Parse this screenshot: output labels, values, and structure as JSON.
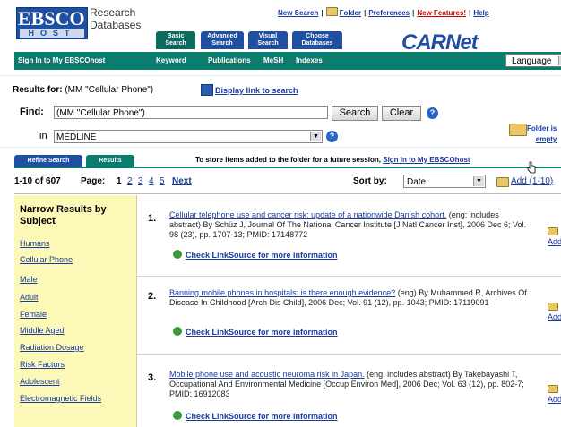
{
  "header": {
    "logo_main": "EBSCO",
    "logo_sub": "HOST",
    "logo_line1": "Research",
    "logo_line2": "Databases",
    "toplinks": [
      "New Search",
      "Folder",
      "Preferences",
      "New Features!",
      "Help"
    ],
    "tabs": [
      {
        "line1": "Basic",
        "line2": "Search"
      },
      {
        "line1": "Advanced",
        "line2": "Search"
      },
      {
        "line1": "Visual",
        "line2": "Search"
      },
      {
        "line1": "Choose",
        "line2": "Databases"
      }
    ],
    "brand": "CARNet"
  },
  "navbar": {
    "signin": "Sign In to My EBSCOhost",
    "items": [
      "Keyword",
      "Publications",
      "MeSH",
      "Indexes"
    ],
    "language": "Language"
  },
  "search": {
    "results_for_label": "Results for:",
    "results_for_query": "(MM \"Cellular Phone\")",
    "display_link": "Display link to search",
    "find_label": "Find:",
    "find_value": "(MM \"Cellular Phone\")",
    "search_button": "Search",
    "clear_button": "Clear",
    "in_label": "in",
    "database": "MEDLINE",
    "folder_text": "Folder is",
    "folder_status": "empty"
  },
  "results_tabs": {
    "refine": "Refine Search",
    "results": "Results",
    "store_message": "To store items added to the folder for a future session,",
    "store_link": "Sign In to My EBSCOhost"
  },
  "pagination": {
    "range": "1-10 of 607",
    "page_label": "Page:",
    "current": "1",
    "pages": [
      "2",
      "3",
      "4",
      "5"
    ],
    "next": "Next",
    "sort_label": "Sort by:",
    "sort_value": "Date",
    "add_link": "Add (1-10)"
  },
  "sidebar": {
    "title": "Narrow Results by Subject",
    "items": [
      "Humans",
      "Cellular Phone",
      "Male",
      "Adult",
      "Female",
      "Middle Aged",
      "Radiation Dosage",
      "Risk Factors",
      "Adolescent",
      "Electromagnetic Fields"
    ]
  },
  "results": [
    {
      "num": "1.",
      "title": "Cellular telephone use and cancer risk: update of a nationwide Danish cohort.",
      "body": "(eng; includes abstract) By Schüz J, Journal Of The National Cancer Institute [J Natl Cancer Inst], 2006 Dec 6; Vol. 98 (23), pp. 1707-13; PMID: 17148772",
      "linksource": "Check LinkSource for more information",
      "add": "Add"
    },
    {
      "num": "2.",
      "title": "Banning mobile phones in hospitals: is there enough evidence?",
      "body": "(eng) By Muhammed R, Archives Of Disease In Childhood [Arch Dis Child], 2006 Dec; Vol. 91 (12), pp. 1043; PMID: 17119091",
      "linksource": "Check LinkSource for more information",
      "add": "Add"
    },
    {
      "num": "3.",
      "title": "Mobile phone use and acoustic neuroma risk in Japan.",
      "body": "(eng; includes abstract) By Takebayashi T, Occupational And Environmental Medicine [Occup Environ Med], 2006 Dec; Vol. 63 (12), pp. 802-7; PMID: 16912083",
      "linksource": "Check LinkSource for more information",
      "add": "Add"
    }
  ],
  "colors": {
    "teal": "#0b7d6e",
    "blue": "#1f4fa0",
    "link": "#1a3a9c",
    "sidebar_bg": "#fbf8b8",
    "new_features": "#cc0000"
  }
}
